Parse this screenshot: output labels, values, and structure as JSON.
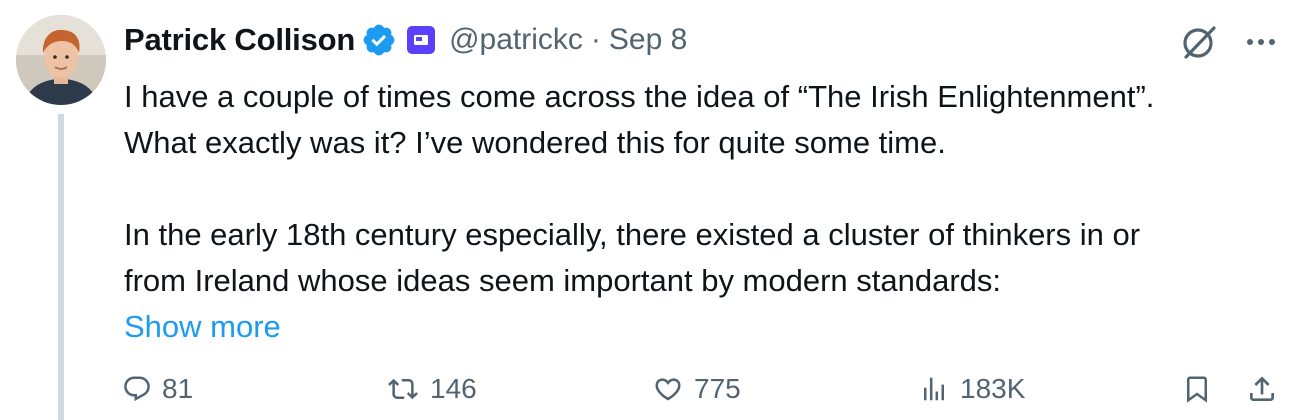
{
  "author": {
    "name": "Patrick Collison",
    "handle": "@patrickc",
    "separator": "·",
    "date": "Sep 8"
  },
  "tweet": {
    "paragraph1_line1": "I have a couple of times come across the idea of “The Irish Enlightenment”.",
    "paragraph1_line2": "What exactly was it? I’ve wondered this for quite some time.",
    "paragraph2_line1": "In the early 18th century especially, there existed a cluster of thinkers in or",
    "paragraph2_line2": "from Ireland whose ideas seem important by modern standards:",
    "show_more": "Show more"
  },
  "stats": {
    "replies": "81",
    "reposts": "146",
    "likes": "775",
    "views": "183K"
  },
  "icons": {
    "verified": "verified-badge-icon",
    "affiliate": "affiliate-badge-icon",
    "grok": "grok-icon",
    "more": "more-icon",
    "reply": "reply-icon",
    "repost": "repost-icon",
    "like": "heart-icon",
    "views": "views-icon",
    "bookmark": "bookmark-icon",
    "share": "share-icon"
  },
  "colors": {
    "link": "#1d9bf0",
    "verified": "#1d9bf0",
    "affiliate": "#5b3ffb",
    "muted": "#536471",
    "text": "#0f1419"
  }
}
